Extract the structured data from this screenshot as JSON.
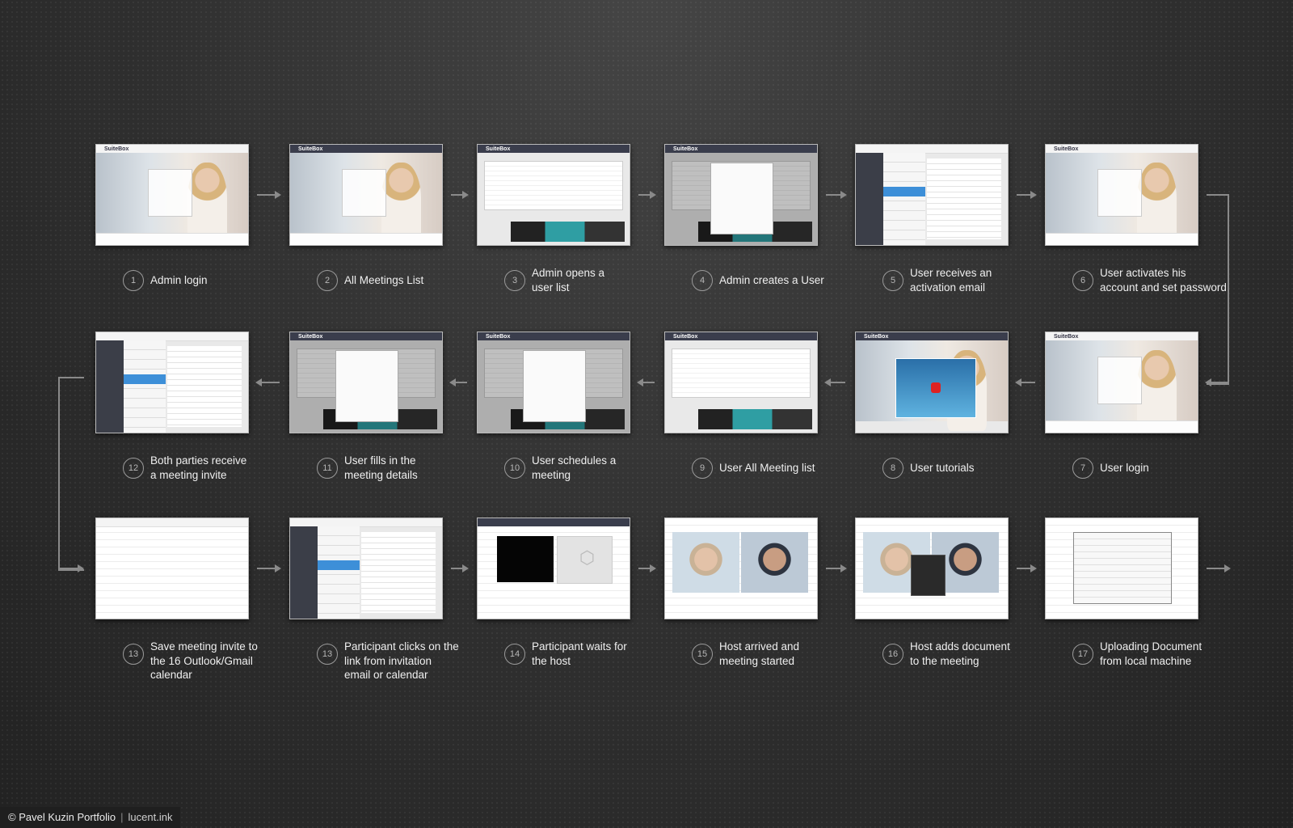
{
  "steps": [
    {
      "num": "1",
      "label": "Admin login",
      "screen": "login"
    },
    {
      "num": "2",
      "label": "All Meetings List",
      "screen": "meetings"
    },
    {
      "num": "3",
      "label": "Admin opens a\nuser list",
      "screen": "userlist"
    },
    {
      "num": "4",
      "label": "Admin creates a User",
      "screen": "createuser"
    },
    {
      "num": "5",
      "label": "User receives an\nactivation email",
      "screen": "email"
    },
    {
      "num": "6",
      "label": "User activates his\naccount and set password",
      "screen": "activate"
    },
    {
      "num": "7",
      "label": "User login",
      "screen": "login"
    },
    {
      "num": "8",
      "label": "User tutorials",
      "screen": "tutorial"
    },
    {
      "num": "9",
      "label": "User All Meeting list",
      "screen": "allmeetings"
    },
    {
      "num": "10",
      "label": "User schedules a\nmeeting",
      "screen": "schedule"
    },
    {
      "num": "11",
      "label": "User fills in the\nmeeting details",
      "screen": "schedule"
    },
    {
      "num": "12",
      "label": "Both parties receive\na meeting invite",
      "screen": "email"
    },
    {
      "num": "13",
      "label": "Save meeting invite to\nthe 16 Outlook/Gmail\ncalendar",
      "screen": "outlook"
    },
    {
      "num": "13",
      "label": "Participant clicks on the\nlink from invitation\nemail or calendar",
      "screen": "email"
    },
    {
      "num": "14",
      "label": "Participant waits for\nthe host",
      "screen": "waiting"
    },
    {
      "num": "15",
      "label": "Host arrived and\nmeeting started",
      "screen": "meeting"
    },
    {
      "num": "16",
      "label": "Host adds document\nto the meeting",
      "screen": "adddoc"
    },
    {
      "num": "17",
      "label": "Uploading Document\nfrom local machine",
      "screen": "upload"
    }
  ],
  "thumb_logo": "SuiteBox",
  "credit": {
    "author": "© Pavel Kuzin Portfolio",
    "site": "lucent.ink"
  },
  "colors": {
    "background": "#2b2b2b",
    "arrow": "#8a8a8a",
    "text": "#efefef",
    "header": "#3a3d4c",
    "teal": "#2f9ea3"
  }
}
